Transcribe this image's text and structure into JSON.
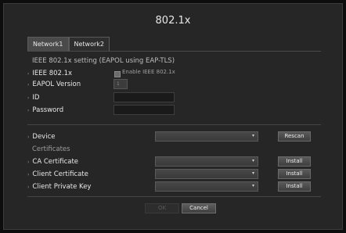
{
  "window": {
    "title": "802.1x"
  },
  "tabs": [
    {
      "label": "Network1",
      "active": true
    },
    {
      "label": "Network2",
      "active": false
    }
  ],
  "section_heading": "IEEE 802.1x setting (EAPOL using EAP-TLS)",
  "ieee": {
    "label": "IEEE 802.1x",
    "checkbox_label": "Enable IEEE 802.1x",
    "checked": false
  },
  "eapol": {
    "label": "EAPOL Version",
    "value": "1"
  },
  "id": {
    "label": "ID",
    "value": ""
  },
  "password": {
    "label": "Password",
    "value": ""
  },
  "device": {
    "label": "Device",
    "value": "",
    "rescan_label": "Rescan"
  },
  "certificates": {
    "heading": "Certificates",
    "ca": {
      "label": "CA Certificate",
      "value": "",
      "install_label": "Install"
    },
    "client": {
      "label": "Client Certificate",
      "value": "",
      "install_label": "Install"
    },
    "key": {
      "label": "Client Private Key",
      "value": "",
      "install_label": "Install"
    }
  },
  "footer": {
    "ok_label": "OK",
    "cancel_label": "Cancel"
  },
  "colors": {
    "background": "#262626",
    "accent": "#4a4a4a"
  }
}
